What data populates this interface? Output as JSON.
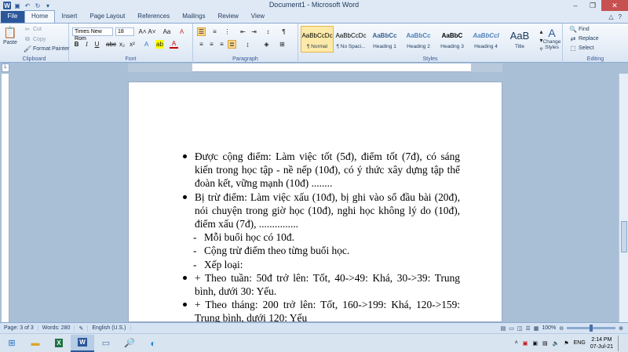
{
  "window": {
    "title": "Document1 - Microsoft Word"
  },
  "tabs": [
    "File",
    "Home",
    "Insert",
    "Page Layout",
    "References",
    "Mailings",
    "Review",
    "View"
  ],
  "clipboard": {
    "paste": "Paste",
    "cut": "Cut",
    "copy": "Copy",
    "format_painter": "Format Painter",
    "label": "Clipboard"
  },
  "font": {
    "name": "Times New Rom",
    "size": "18",
    "label": "Font"
  },
  "paragraph": {
    "label": "Paragraph"
  },
  "styles": {
    "label": "Styles",
    "items": [
      {
        "preview": "AaBbCcDc",
        "name": "¶ Normal"
      },
      {
        "preview": "AaBbCcDc",
        "name": "¶ No Spaci..."
      },
      {
        "preview": "AaBbCc",
        "name": "Heading 1"
      },
      {
        "preview": "AaBbCc",
        "name": "Heading 2"
      },
      {
        "preview": "AaBbC",
        "name": "Heading 3"
      },
      {
        "preview": "AaBbCcI",
        "name": "Heading 4"
      },
      {
        "preview": "AaB",
        "name": "Title"
      }
    ],
    "change_styles": "Change Styles"
  },
  "editing": {
    "find": "Find",
    "replace": "Replace",
    "select": "Select",
    "label": "Editing"
  },
  "document": {
    "bullets": [
      {
        "text": "Được cộng điểm: Làm việc tốt (5đ), điểm tốt (7đ), có sáng kiến trong học tập - nề nếp (10đ), có ý thức xây dựng tập thể đoàn kết, vững mạnh (10đ) ........"
      },
      {
        "text": "Bị trừ điểm: Làm việc xấu (10đ), bị ghi vào sổ đầu bài (20đ), nói chuyện trong giờ học (10đ), nghi học không lý do (10đ), điểm xấu (7đ), ..............."
      }
    ],
    "dashes": [
      "Mỗi buổi học có 10đ.",
      "Cộng trừ điểm theo từng buổi học.",
      "Xếp loại:"
    ],
    "bullets2": [
      "+ Theo tuần: 50đ trở lên: Tốt, 40->49: Khá, 30->39: Trung bình, dưới 30: Yếu.",
      "+ Theo tháng: 200 trở lên: Tốt, 160->199: Khá, 120->159: Trung bình, dưới 120: Yếu"
    ]
  },
  "status": {
    "page": "Page: 3 of 3",
    "words": "Words: 280",
    "language": "English (U.S.)",
    "zoom": "100%"
  },
  "tray": {
    "lang": "ENG",
    "time": "2:14 PM",
    "date": "07-Jul-21"
  }
}
